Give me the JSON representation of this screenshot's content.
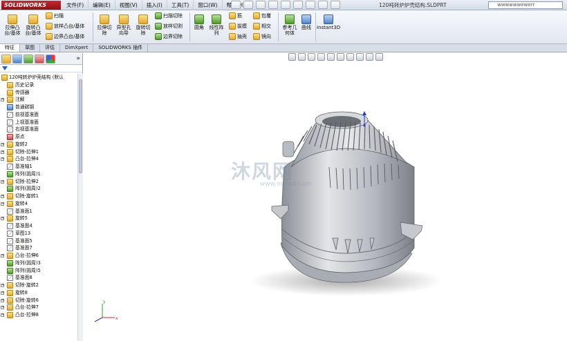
{
  "app": {
    "logo": "SOLIDWORKS",
    "window_title": "120吨转炉炉壳结构.SLDPRT"
  },
  "menu": [
    "文件(F)",
    "编辑(E)",
    "视图(V)",
    "插入(I)",
    "工具(T)",
    "窗口(W)",
    "帮助(H)"
  ],
  "search": {
    "placeholder": "wwwwwwewerr"
  },
  "ribbon": {
    "extrude_boss": "拉伸凸\n台/基体",
    "revolve_boss": "旋转凸\n台/基体",
    "sweep": "扫描",
    "loft_boss": "放样凸台/基体",
    "boundary_boss": "边界凸台/基体",
    "extrude_cut": "拉伸切\n除",
    "hole_wizard": "异型孔\n向导",
    "revolve_cut": "旋转切\n除",
    "sweep_cut": "扫描切除",
    "loft_cut": "放样切割",
    "boundary_cut": "边界切除",
    "fillet": "圆角",
    "linear_pattern": "线性阵\n列",
    "rib": "筋",
    "draft": "拔模",
    "shell": "抽壳",
    "wrap": "包覆",
    "intersect": "相交",
    "mirror": "镜向",
    "ref_geometry": "参考几\n何体",
    "curves": "曲线",
    "instant3d": "Instant3D"
  },
  "tabs": [
    "特征",
    "草图",
    "评估",
    "DimXpert",
    "SOLIDWORKS 插件"
  ],
  "tree": [
    {
      "label": "120吨转炉炉壳结构  (默认",
      "type": "root"
    },
    {
      "label": "历史记录",
      "type": "folder"
    },
    {
      "label": "传感器",
      "type": "folder"
    },
    {
      "label": "注解",
      "type": "annot",
      "expand": true
    },
    {
      "label": "普通碳钢",
      "type": "mat"
    },
    {
      "label": "前视基准面",
      "type": "plane"
    },
    {
      "label": "上视基准面",
      "type": "plane"
    },
    {
      "label": "右视基准面",
      "type": "plane"
    },
    {
      "label": "原点",
      "type": "origin"
    },
    {
      "label": "旋转2",
      "type": "feat",
      "expand": true
    },
    {
      "label": "切除-拉伸1",
      "type": "feat",
      "expand": true
    },
    {
      "label": "凸台-拉伸4",
      "type": "feat",
      "expand": true
    },
    {
      "label": "基准轴1",
      "type": "axis"
    },
    {
      "label": "阵列(圆周)1",
      "type": "pattern"
    },
    {
      "label": "切除-拉伸2",
      "type": "feat",
      "expand": true
    },
    {
      "label": "阵列(圆周)2",
      "type": "pattern"
    },
    {
      "label": "切除-旋转1",
      "type": "feat",
      "expand": true
    },
    {
      "label": "旋转4",
      "type": "feat",
      "expand": true
    },
    {
      "label": "基准面1",
      "type": "plane"
    },
    {
      "label": "旋转5",
      "type": "feat",
      "expand": true
    },
    {
      "label": "基准面4",
      "type": "plane"
    },
    {
      "label": "草图13",
      "type": "sketch"
    },
    {
      "label": "基准面5",
      "type": "plane"
    },
    {
      "label": "基准面7",
      "type": "plane"
    },
    {
      "label": "凸台-拉伸6",
      "type": "feat",
      "expand": true
    },
    {
      "label": "阵列(圆周)3",
      "type": "pattern"
    },
    {
      "label": "阵列(圆周)5",
      "type": "pattern"
    },
    {
      "label": "基准面8",
      "type": "plane"
    },
    {
      "label": "切除-旋转2",
      "type": "feat",
      "expand": true
    },
    {
      "label": "旋转8",
      "type": "feat",
      "expand": true
    },
    {
      "label": "切除-旋转6",
      "type": "feat",
      "expand": true
    },
    {
      "label": "凸台-拉伸7",
      "type": "feat",
      "expand": true
    },
    {
      "label": "凸台-拉伸8",
      "type": "feat",
      "expand": true
    }
  ],
  "viewport": {
    "watermark": "沐风网",
    "watermark_url": "www.mfcad.com",
    "triad_x": "x",
    "triad_y": "y"
  },
  "colors": {
    "accent": "#2a62b8",
    "model": "#b9bcc4"
  }
}
